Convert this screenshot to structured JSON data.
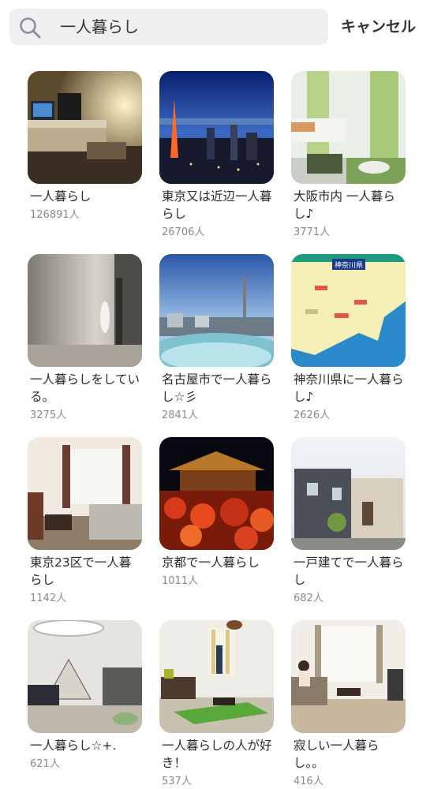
{
  "search": {
    "query": "一人暮らし",
    "icon": "search-icon",
    "cancel_label": "キャンセル"
  },
  "results": [
    {
      "name": "一人暮らし",
      "count": "126891人",
      "image": "living-room-night-photo"
    },
    {
      "name": "東京又は近辺一人暮らし",
      "count": "26706人",
      "image": "tokyo-tower-night-photo"
    },
    {
      "name": "大阪市内 一人暮らし♪",
      "count": "3771人",
      "image": "bright-living-room-photo"
    },
    {
      "name": "一人暮らしをしている。",
      "count": "3275人",
      "image": "empty-apartment-photo"
    },
    {
      "name": "名古屋市で一人暮らし☆彡",
      "count": "2841人",
      "image": "nagoya-tv-tower-photo"
    },
    {
      "name": "神奈川県に一人暮らし♪",
      "count": "2626人",
      "image": "kanagawa-map",
      "map_label": "神奈川県"
    },
    {
      "name": "東京23区で一人暮らし",
      "count": "1142人",
      "image": "sofa-room-photo"
    },
    {
      "name": "京都で一人暮らし",
      "count": "1011人",
      "image": "kyoto-temple-night-photo"
    },
    {
      "name": "一戸建てで一人暮らし",
      "count": "682人",
      "image": "detached-house-photo"
    },
    {
      "name": "一人暮らし☆+.",
      "count": "621人",
      "image": "loft-living-room-photo"
    },
    {
      "name": "一人暮らしの人が好き！",
      "count": "537人",
      "image": "person-in-living-room-photo"
    },
    {
      "name": "寂しい一人暮らし。。",
      "count": "416人",
      "image": "woman-on-sofa-photo"
    }
  ],
  "colors": {
    "search_bg": "#eeeff1",
    "count_text": "#8a8a8a"
  }
}
